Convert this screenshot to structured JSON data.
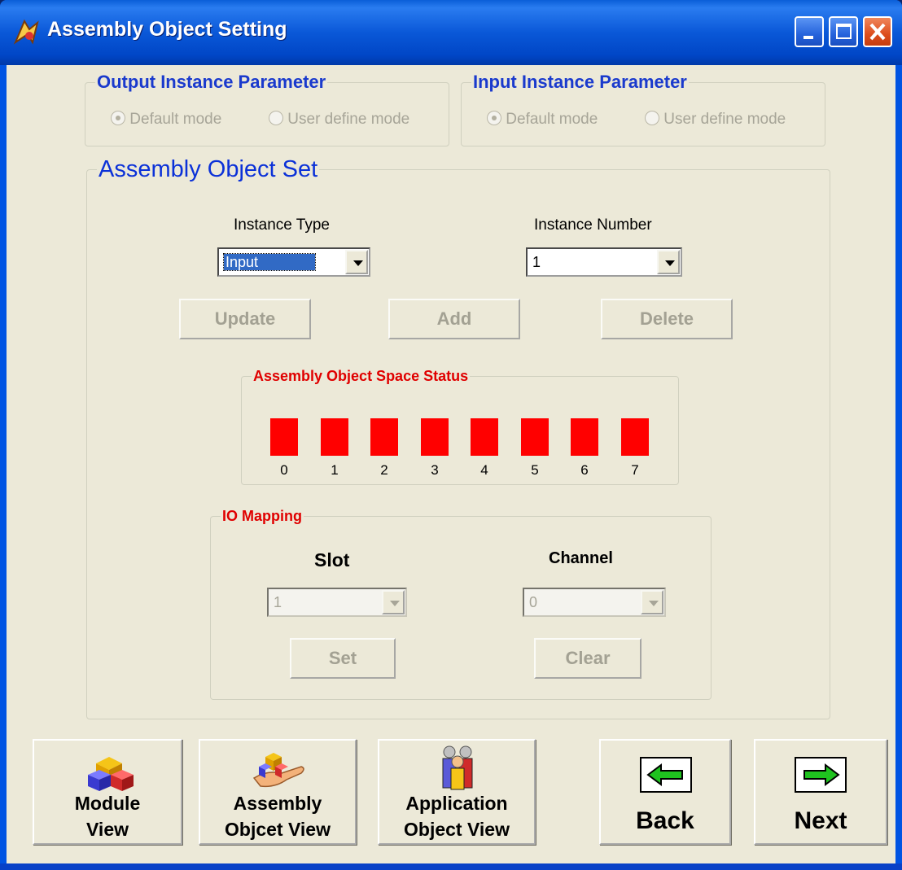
{
  "window": {
    "title": "Assembly Object Setting"
  },
  "output_instance": {
    "legend": "Output Instance Parameter",
    "default_mode": "Default mode",
    "user_define_mode": "User define mode",
    "selected": "Default mode"
  },
  "input_instance": {
    "legend": "Input Instance Parameter",
    "default_mode": "Default mode",
    "user_define_mode": "User define mode",
    "selected": "Default mode"
  },
  "assembly_set": {
    "legend": "Assembly Object Set",
    "instance_type_label": "Instance Type",
    "instance_type_value": "Input",
    "instance_number_label": "Instance Number",
    "instance_number_value": "1",
    "update_label": "Update",
    "add_label": "Add",
    "delete_label": "Delete"
  },
  "space_status": {
    "legend": "Assembly Object Space Status",
    "slots": [
      "0",
      "1",
      "2",
      "3",
      "4",
      "5",
      "6",
      "7"
    ],
    "color": "#ff0000"
  },
  "io_mapping": {
    "legend": "IO Mapping",
    "slot_label": "Slot",
    "slot_value": "1",
    "channel_label": "Channel",
    "channel_value": "0",
    "set_label": "Set",
    "clear_label": "Clear"
  },
  "nav": {
    "module_view": [
      "Module",
      "View"
    ],
    "assembly_view": [
      "Assembly",
      "Objcet View"
    ],
    "application_view": [
      "Application",
      "Object View"
    ],
    "back": "Back",
    "next": "Next"
  }
}
